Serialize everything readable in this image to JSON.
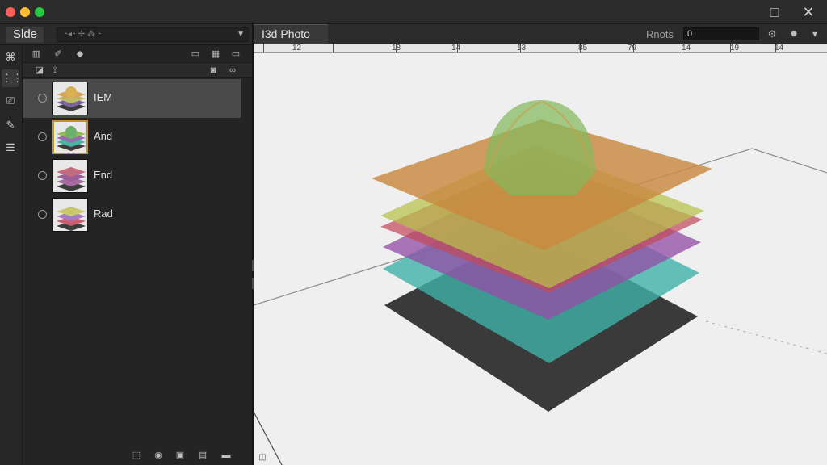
{
  "window": {
    "buttons": {
      "maximize_icon": "maximize-icon",
      "close_icon": "close-icon"
    },
    "traffic_lights": [
      "#ff5f57",
      "#ffbd2e",
      "#28c840"
    ]
  },
  "left_panel": {
    "title": "Slde",
    "select": {
      "value": "⁃◂⁃  ✢  ⁂  ⁃"
    }
  },
  "layers": [
    {
      "name": "IEM",
      "selected": true,
      "thumb_colors": [
        "#3d3d3d",
        "#d7a45d",
        "#bdbd65",
        "#7d62a1"
      ]
    },
    {
      "name": "And",
      "selected": false,
      "thumb_colors": [
        "#3d3d3d",
        "#4db3a3",
        "#9b6bb0",
        "#8ebc55"
      ]
    },
    {
      "name": "End",
      "selected": false,
      "thumb_colors": [
        "#3d3d3d",
        "#a76aa2",
        "#9b5d98",
        "#c36a7c"
      ]
    },
    {
      "name": "Rad",
      "selected": false,
      "thumb_colors": [
        "#3d3d3d",
        "#cc5f6f",
        "#a57bc2",
        "#c9c96c"
      ]
    }
  ],
  "viewport": {
    "doc_tab": "I3d Photo",
    "roots_label": "Rnots",
    "roots_value": "0",
    "ruler_labels": [
      "12",
      "18",
      "14",
      "13",
      "85",
      "79",
      "14",
      "19",
      "14"
    ]
  },
  "scene": {
    "layer_colors": {
      "base": "#2f2f2f",
      "teal": "#3fb1a8",
      "purple": "#9450a6",
      "red": "#c14a5d",
      "yellow": "#b7c04a",
      "orange": "#c9893f",
      "dome": "#83b85b"
    }
  }
}
